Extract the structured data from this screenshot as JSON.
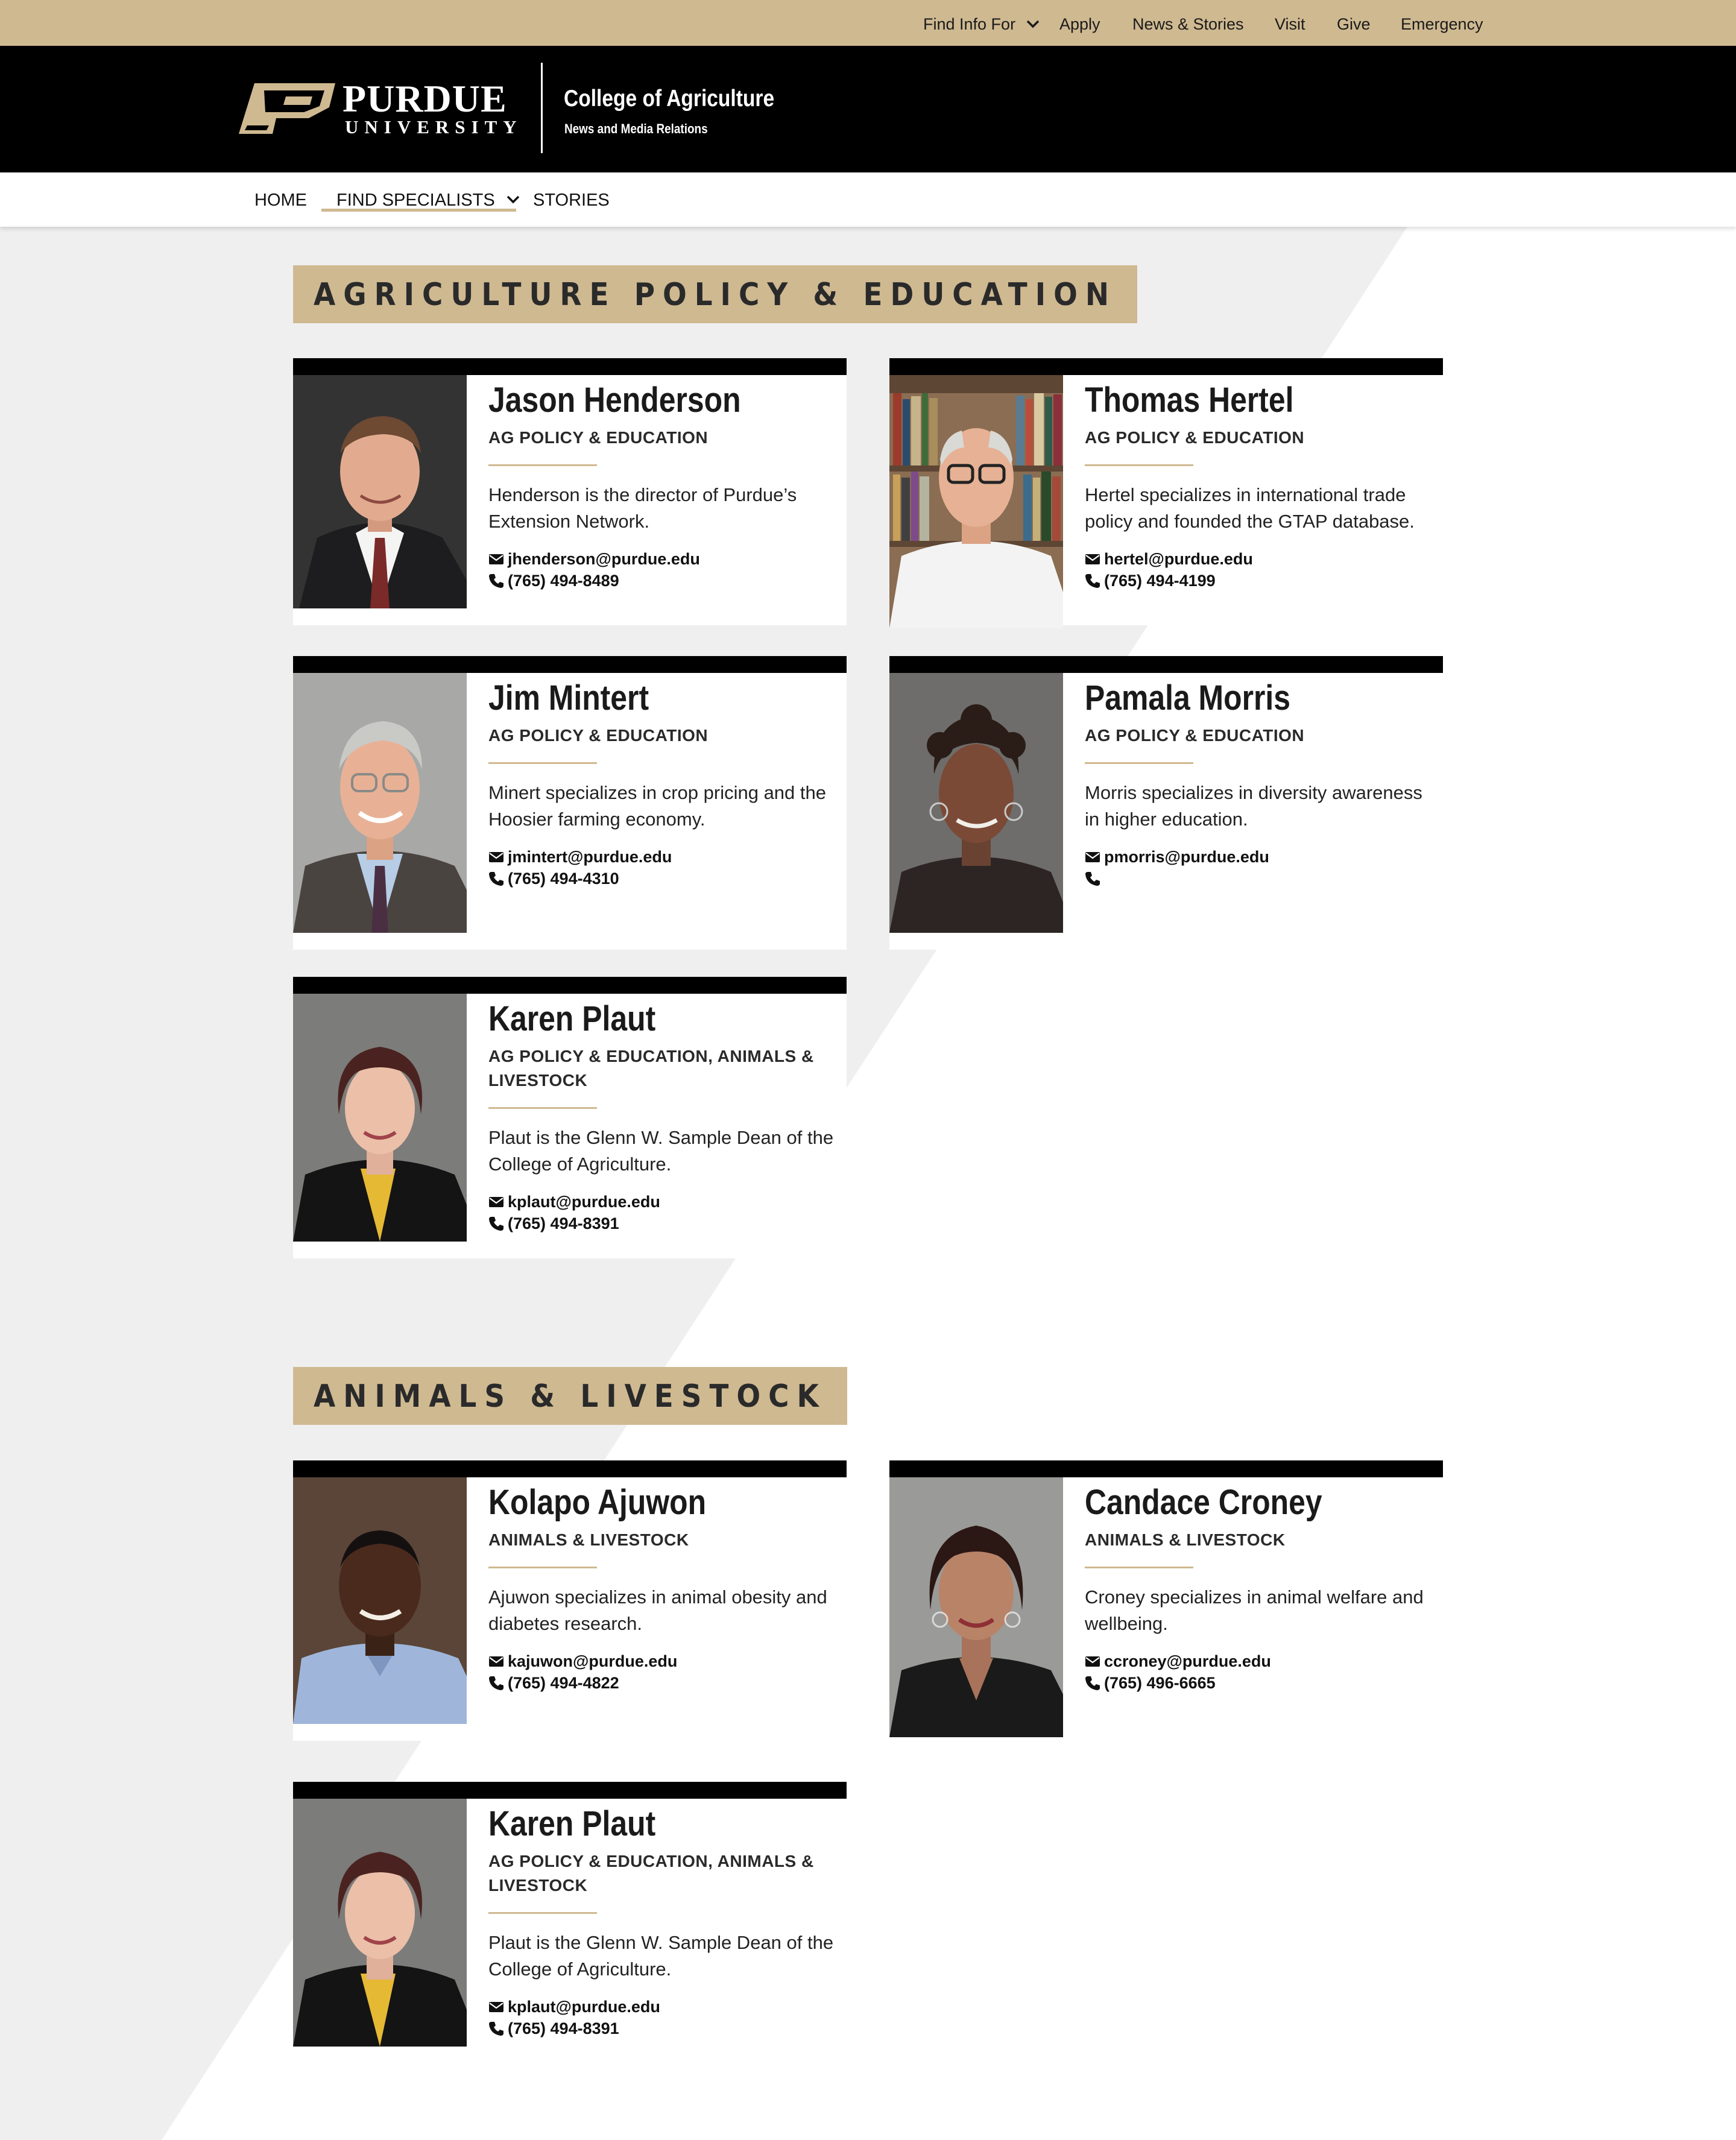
{
  "utility_nav": {
    "find_info": "Find Info For",
    "apply": "Apply",
    "news": "News & Stories",
    "visit": "Visit",
    "give": "Give",
    "emergency": "Emergency"
  },
  "brand": {
    "university": "PURDUE",
    "university_sub": "UNIVERSITY",
    "college": "College of Agriculture",
    "department": "News and Media Relations"
  },
  "main_nav": {
    "home": "HOME",
    "find_specialists": "FIND SPECIALISTS",
    "stories": "STORIES"
  },
  "sections": [
    {
      "title": "AGRICULTURE POLICY & EDUCATION",
      "specialists": [
        {
          "name": "Jason Henderson",
          "dept": "AG POLICY & EDUCATION",
          "bio": "Henderson is the director of Purdue’s Extension Network.",
          "email": "jhenderson@purdue.edu",
          "phone": "(765) 494-8489",
          "photo": "photo-jason-henderson"
        },
        {
          "name": "Thomas Hertel",
          "dept": "AG POLICY & EDUCATION",
          "bio": "Hertel specializes in international trade policy and founded the GTAP database.",
          "email": "hertel@purdue.edu",
          "phone": "(765) 494-4199",
          "photo": "photo-thomas-hertel"
        },
        {
          "name": "Jim Mintert",
          "dept": "AG POLICY & EDUCATION",
          "bio": "Minert specializes in crop pricing and the Hoosier farming economy.",
          "email": "jmintert@purdue.edu",
          "phone": "(765) 494-4310",
          "photo": "photo-jim-mintert"
        },
        {
          "name": "Pamala Morris",
          "dept": "AG POLICY & EDUCATION",
          "bio": "Morris specializes in diversity awareness in higher education.",
          "email": "pmorris@purdue.edu",
          "phone": "",
          "photo": "photo-pamala-morris"
        },
        {
          "name": "Karen Plaut",
          "dept": "AG POLICY & EDUCATION, ANIMALS & LIVESTOCK",
          "bio": "Plaut is the Glenn W. Sample Dean of the College of Agriculture.",
          "email": "kplaut@purdue.edu",
          "phone": "(765) 494-8391",
          "photo": "photo-karen-plaut"
        }
      ]
    },
    {
      "title": "ANIMALS & LIVESTOCK",
      "specialists": [
        {
          "name": "Kolapo Ajuwon",
          "dept": "ANIMALS & LIVESTOCK",
          "bio": "Ajuwon specializes in animal obesity and diabetes research.",
          "email": "kajuwon@purdue.edu",
          "phone": "(765) 494-4822",
          "photo": "photo-kolapo-ajuwon"
        },
        {
          "name": "Candace Croney",
          "dept": "ANIMALS & LIVESTOCK",
          "bio": "Croney specializes in animal welfare and wellbeing.",
          "email": "ccroney@purdue.edu",
          "phone": "(765) 496-6665",
          "photo": "photo-candace-croney"
        },
        {
          "name": "Karen Plaut",
          "dept": "AG POLICY & EDUCATION, ANIMALS & LIVESTOCK",
          "bio": "Plaut is the Glenn W. Sample Dean of the College of Agriculture.",
          "email": "kplaut@purdue.edu",
          "phone": "(765) 494-8391",
          "photo": "photo-karen-plaut"
        }
      ]
    }
  ],
  "colors": {
    "gold": "#CFB991",
    "black": "#000000",
    "background_shade": "#EFEFEF"
  },
  "icons": [
    "chevron-down-icon",
    "envelope-icon",
    "phone-icon",
    "purdue-p-logo"
  ]
}
